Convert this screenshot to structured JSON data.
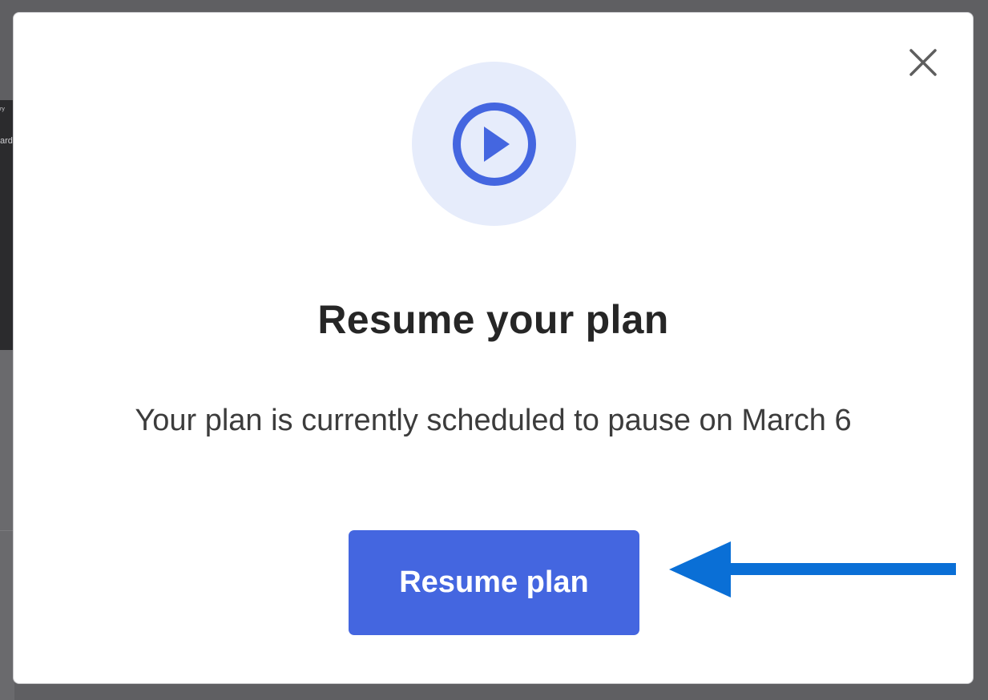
{
  "background": {
    "fragment_top": "ry",
    "fragment_side": "ard"
  },
  "modal": {
    "icon": "play-circle-icon",
    "close_icon": "close-icon",
    "title": "Resume your plan",
    "message": "Your plan is currently scheduled to pause on March 6",
    "primary_button_label": "Resume plan"
  },
  "annotation": {
    "icon": "arrow-left-icon",
    "color": "#0a6fd6"
  },
  "colors": {
    "accent": "#4466e0",
    "icon_bg": "#e6ecfb",
    "overlay": "#5f5f62"
  }
}
